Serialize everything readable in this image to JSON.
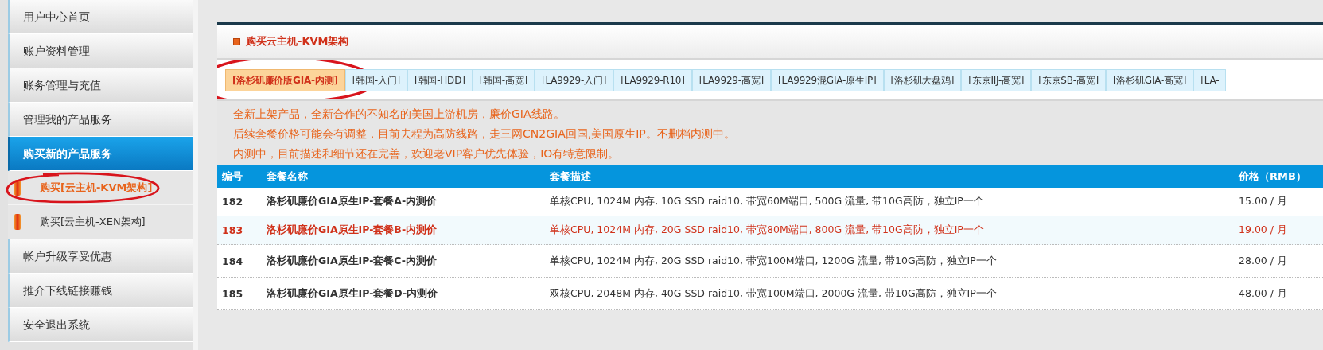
{
  "sidebar": {
    "items": [
      {
        "label": "用户中心首页",
        "kind": "main",
        "selected": false
      },
      {
        "label": "账户资料管理",
        "kind": "main",
        "selected": false
      },
      {
        "label": "账务管理与充值",
        "kind": "main",
        "selected": false
      },
      {
        "label": "管理我的产品服务",
        "kind": "main",
        "selected": false
      },
      {
        "label": "购买新的产品服务",
        "kind": "main",
        "selected": true
      },
      {
        "label": "购买[云主机-KVM架构]",
        "kind": "sub",
        "selected": true,
        "circled": true
      },
      {
        "label": "购买[云主机-XEN架构]",
        "kind": "sub",
        "selected": false,
        "circled": false
      },
      {
        "label": "帐户升级享受优惠",
        "kind": "main",
        "selected": false
      },
      {
        "label": "推介下线链接赚钱",
        "kind": "main",
        "selected": false
      },
      {
        "label": "安全退出系统",
        "kind": "main",
        "selected": false
      }
    ]
  },
  "panel": {
    "title": "购买云主机-KVM架构",
    "tabs": [
      {
        "label": "[洛杉矶廉价版GIA-内测]",
        "selected": true,
        "circled": true
      },
      {
        "label": "[韩国-入门]",
        "selected": false,
        "circled": false
      },
      {
        "label": "[韩国-HDD]",
        "selected": false,
        "circled": false
      },
      {
        "label": "[韩国-高宽]",
        "selected": false,
        "circled": false
      },
      {
        "label": "[LA9929-入门]",
        "selected": false,
        "circled": false
      },
      {
        "label": "[LA9929-R10]",
        "selected": false,
        "circled": false
      },
      {
        "label": "[LA9929-高宽]",
        "selected": false,
        "circled": false
      },
      {
        "label": "[LA9929混GIA-原生IP]",
        "selected": false,
        "circled": false
      },
      {
        "label": "[洛杉矶大盘鸡]",
        "selected": false,
        "circled": false
      },
      {
        "label": "[东京IIJ-高宽]",
        "selected": false,
        "circled": false
      },
      {
        "label": "[东京SB-高宽]",
        "selected": false,
        "circled": false
      },
      {
        "label": "[洛杉矶GIA-高宽]",
        "selected": false,
        "circled": false
      },
      {
        "label": "[LA-",
        "selected": false,
        "circled": false
      }
    ],
    "notes": [
      "全新上架产品，全新合作的不知名的美国上游机房，廉价GIA线路。",
      "后续套餐价格可能会有调整，目前去程为高防线路，走三网CN2GIA回国,美国原生IP。不删档内测中。",
      "内测中，目前描述和细节还在完善，欢迎老VIP客户优先体验，IO有特意限制。"
    ],
    "table": {
      "columns": [
        "编号",
        "套餐名称",
        "套餐描述",
        "价格（RMB）"
      ],
      "rows": [
        {
          "cells": [
            "182",
            "洛杉矶廉价GIA原生IP-套餐A-内测价",
            "单核CPU, 1024M 内存, 10G SSD raid10, 带宽60M端口, 500G 流量, 带10G高防，独立IP一个",
            "15.00 / 月"
          ],
          "highlighted": false
        },
        {
          "cells": [
            "183",
            "洛杉矶廉价GIA原生IP-套餐B-内测价",
            "单核CPU, 1024M 内存, 20G SSD raid10, 带宽80M端口, 800G 流量, 带10G高防，独立IP一个",
            "19.00 / 月"
          ],
          "highlighted": true
        },
        {
          "cells": [
            "184",
            "洛杉矶廉价GIA原生IP-套餐C-内测价",
            "单核CPU, 1024M 内存, 20G SSD raid10, 带宽100M端口, 1200G 流量, 带10G高防，独立IP一个",
            "28.00 / 月"
          ],
          "highlighted": false
        },
        {
          "cells": [
            "185",
            "洛杉矶廉价GIA原生IP-套餐D-内测价",
            "双核CPU, 2048M 内存, 40G SSD raid10, 带宽100M端口, 2000G 流量, 带10G高防，独立IP一个",
            "48.00 / 月"
          ],
          "highlighted": false
        }
      ]
    }
  }
}
